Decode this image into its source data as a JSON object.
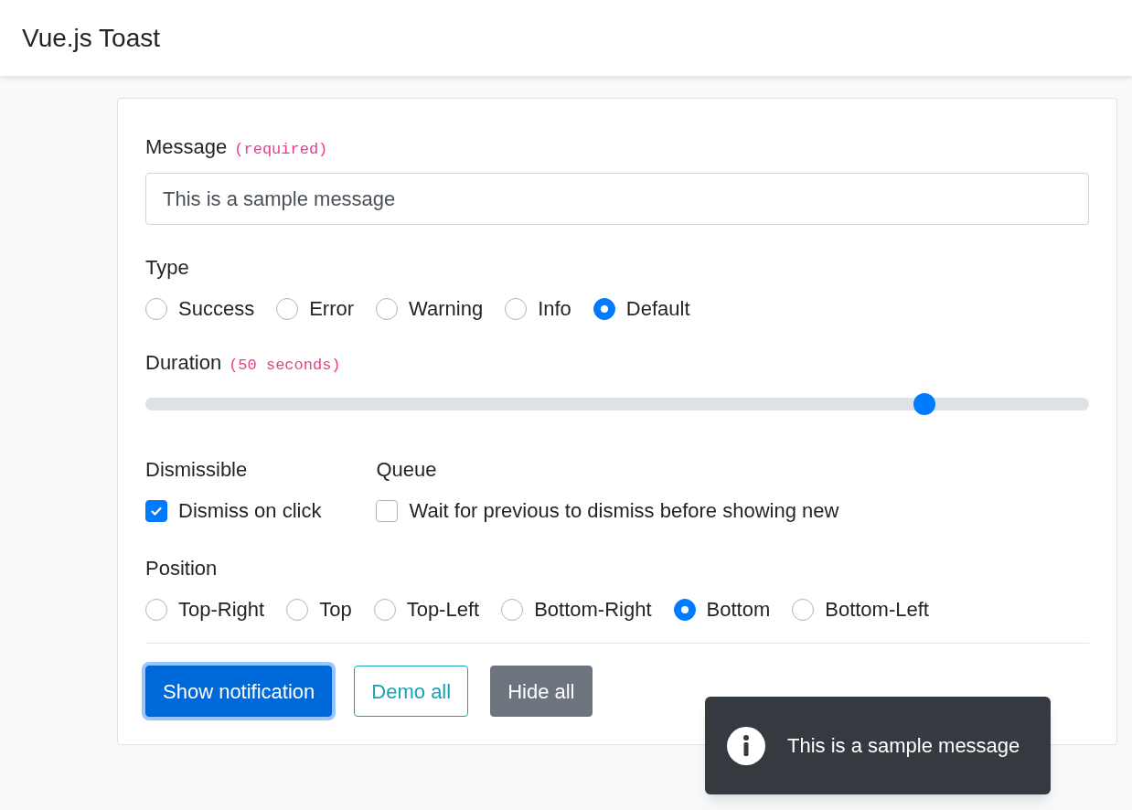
{
  "navbar": {
    "title": "Vue.js Toast"
  },
  "message": {
    "label": "Message",
    "hint": "(required)",
    "value": "This is a sample message"
  },
  "type": {
    "label": "Type",
    "options": [
      {
        "label": "Success",
        "selected": false
      },
      {
        "label": "Error",
        "selected": false
      },
      {
        "label": "Warning",
        "selected": false
      },
      {
        "label": "Info",
        "selected": false
      },
      {
        "label": "Default",
        "selected": true
      }
    ]
  },
  "duration": {
    "label": "Duration",
    "hint": "(50 seconds)",
    "level": 0.826
  },
  "dismissible": {
    "label": "Dismissible",
    "option": "Dismiss on click",
    "checked": true
  },
  "queue": {
    "label": "Queue",
    "option": "Wait for previous to dismiss before showing new",
    "checked": false
  },
  "position": {
    "label": "Position",
    "options": [
      {
        "label": "Top-Right",
        "selected": false
      },
      {
        "label": "Top",
        "selected": false
      },
      {
        "label": "Top-Left",
        "selected": false
      },
      {
        "label": "Bottom-Right",
        "selected": false
      },
      {
        "label": "Bottom",
        "selected": true
      },
      {
        "label": "Bottom-Left",
        "selected": false
      }
    ]
  },
  "buttons": [
    {
      "label": "Show notification",
      "kind": "primary",
      "focused": true
    },
    {
      "label": "Demo all",
      "kind": "outline",
      "focused": false
    },
    {
      "label": "Hide all",
      "kind": "secondary",
      "focused": false
    }
  ],
  "toast": {
    "message": "This is a sample message"
  }
}
